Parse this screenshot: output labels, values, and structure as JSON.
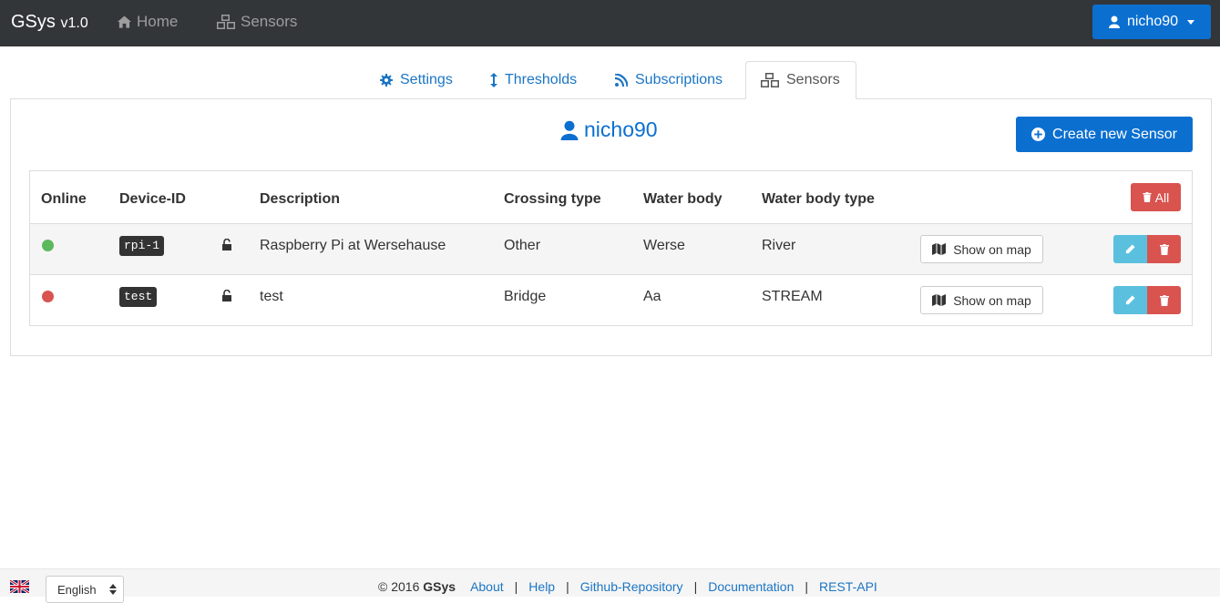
{
  "navbar": {
    "brand": "GSys",
    "version": "v1.0",
    "links": [
      {
        "label": "Home",
        "icon": "home-icon"
      },
      {
        "label": "Sensors",
        "icon": "cubes-icon"
      }
    ],
    "user": "nicho90"
  },
  "tabs": [
    {
      "label": "Settings",
      "icon": "gear-icon"
    },
    {
      "label": "Thresholds",
      "icon": "vertical-arrows-icon"
    },
    {
      "label": "Subscriptions",
      "icon": "rss-icon"
    },
    {
      "label": "Sensors",
      "icon": "cubes-icon",
      "active": true
    }
  ],
  "panel": {
    "username": "nicho90",
    "create_label": "Create new Sensor",
    "delete_all_label": "All"
  },
  "table": {
    "headers": [
      "Online",
      "Device-ID",
      "Description",
      "Crossing type",
      "Water body",
      "Water body type"
    ],
    "rows": [
      {
        "online": true,
        "device_id": "rpi-1",
        "description": "Raspberry Pi at Wersehause",
        "crossing_type": "Other",
        "water_body": "Werse",
        "water_body_type": "River",
        "map_label": "Show on map"
      },
      {
        "online": false,
        "device_id": "test",
        "description": "test",
        "crossing_type": "Bridge",
        "water_body": "Aa",
        "water_body_type": "STREAM",
        "map_label": "Show on map"
      }
    ]
  },
  "footer": {
    "language": "English",
    "copyright": "© 2016",
    "brand": "GSys",
    "links": [
      "About",
      "Help",
      "Github-Repository",
      "Documentation",
      "REST-API"
    ]
  },
  "colors": {
    "navbar": "#333639",
    "primary": "#0b6fd0",
    "danger": "#d9534f",
    "info": "#5bc0de",
    "online": "#5cb85c",
    "offline": "#d9534f"
  }
}
